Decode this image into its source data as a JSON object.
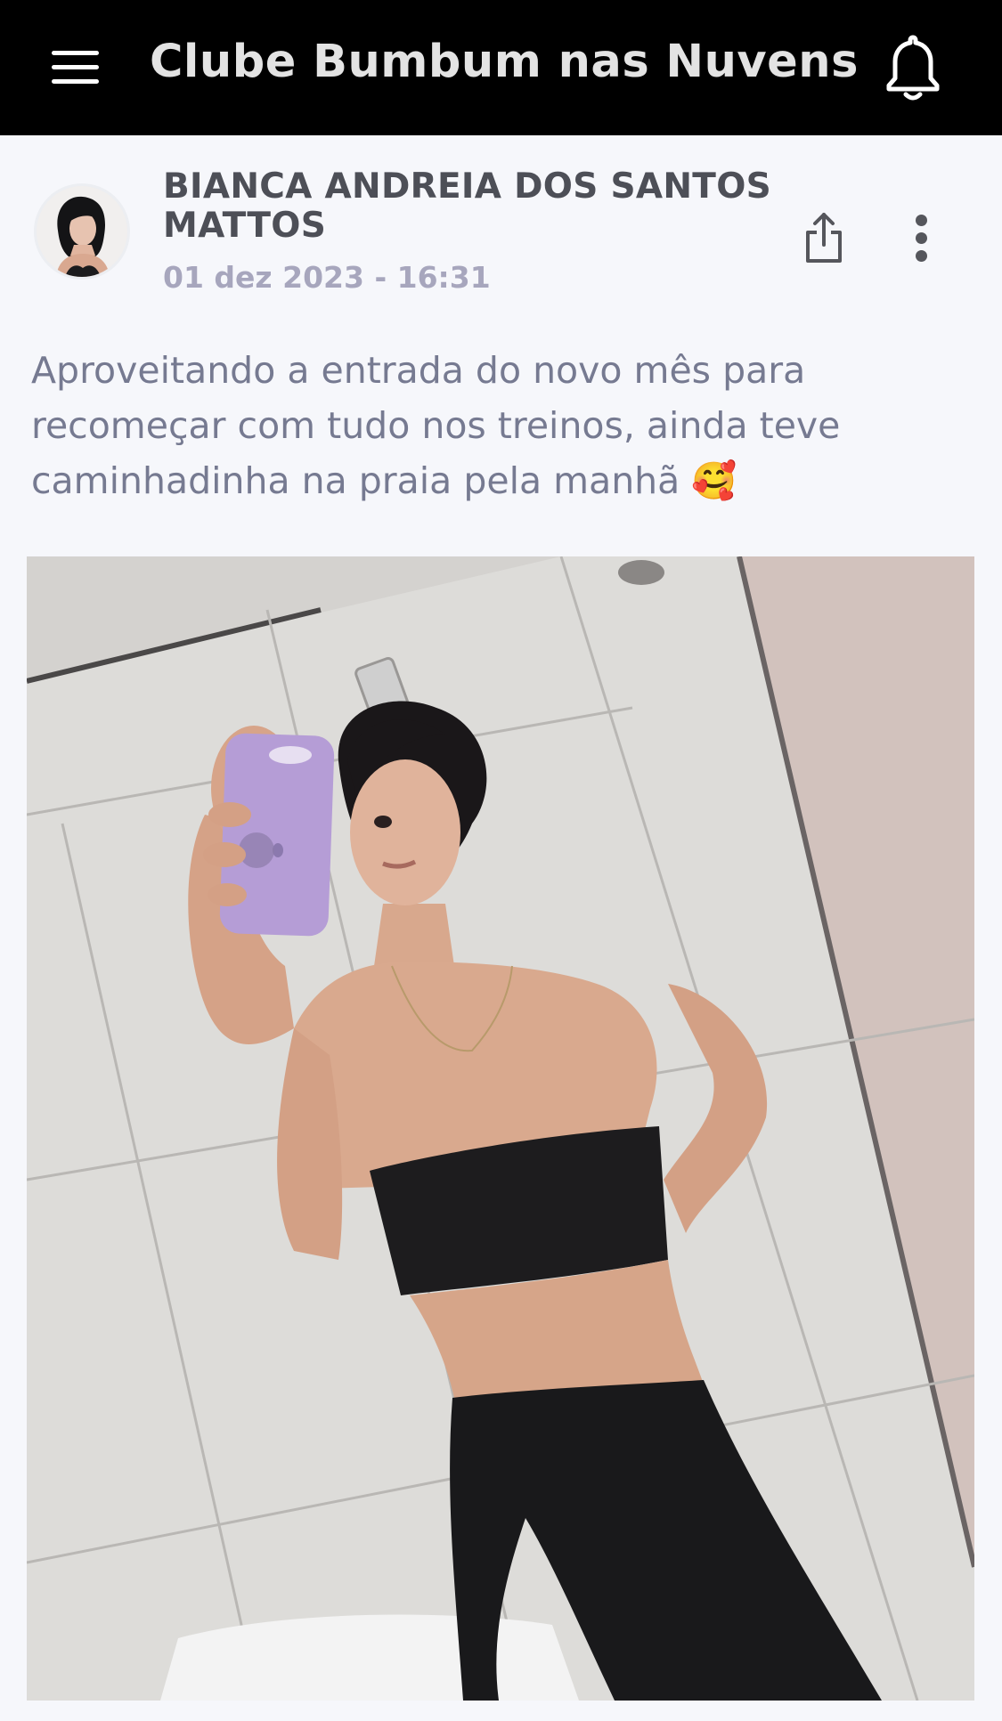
{
  "header": {
    "title": "Clube Bumbum nas Nuvens",
    "menu_icon": "hamburger-menu-icon",
    "notification_icon": "bell-icon"
  },
  "post": {
    "author": "BIANCA ANDREIA DOS SANTOS MATTOS",
    "date": "01 dez 2023 - 16:31",
    "text": "Aproveitando a entrada do novo mês para recomeçar com tudo nos treinos, ainda teve caminhadinha na praia pela manhã 🥰",
    "share_icon": "share-icon",
    "more_icon": "more-vertical-icon"
  },
  "colors": {
    "topbar_bg": "#000000",
    "page_bg": "#f6f7fb",
    "author_text": "#4d4f57",
    "date_text": "#a7a6bd",
    "body_text": "#767a91"
  }
}
